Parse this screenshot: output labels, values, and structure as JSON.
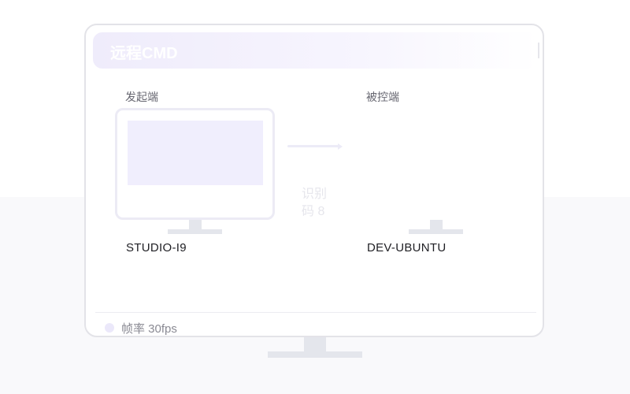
{
  "window": {
    "title": "远程CMD"
  },
  "initiator": {
    "label": "发起端",
    "device_name": "STUDIO-I9"
  },
  "controlled": {
    "label": "被控端",
    "device_name": "DEV-UBUNTU"
  },
  "connection": {
    "code_text": "识别码 8"
  },
  "status": {
    "frame_rate_text": "帧率 30fps"
  },
  "colors": {
    "accent_light": "#efecfb",
    "screen_fill": "#f0eefd",
    "border": "#e3e3e8",
    "stand": "#e4e6ec",
    "text_dark": "#202025",
    "text_muted": "#8a8a93"
  }
}
